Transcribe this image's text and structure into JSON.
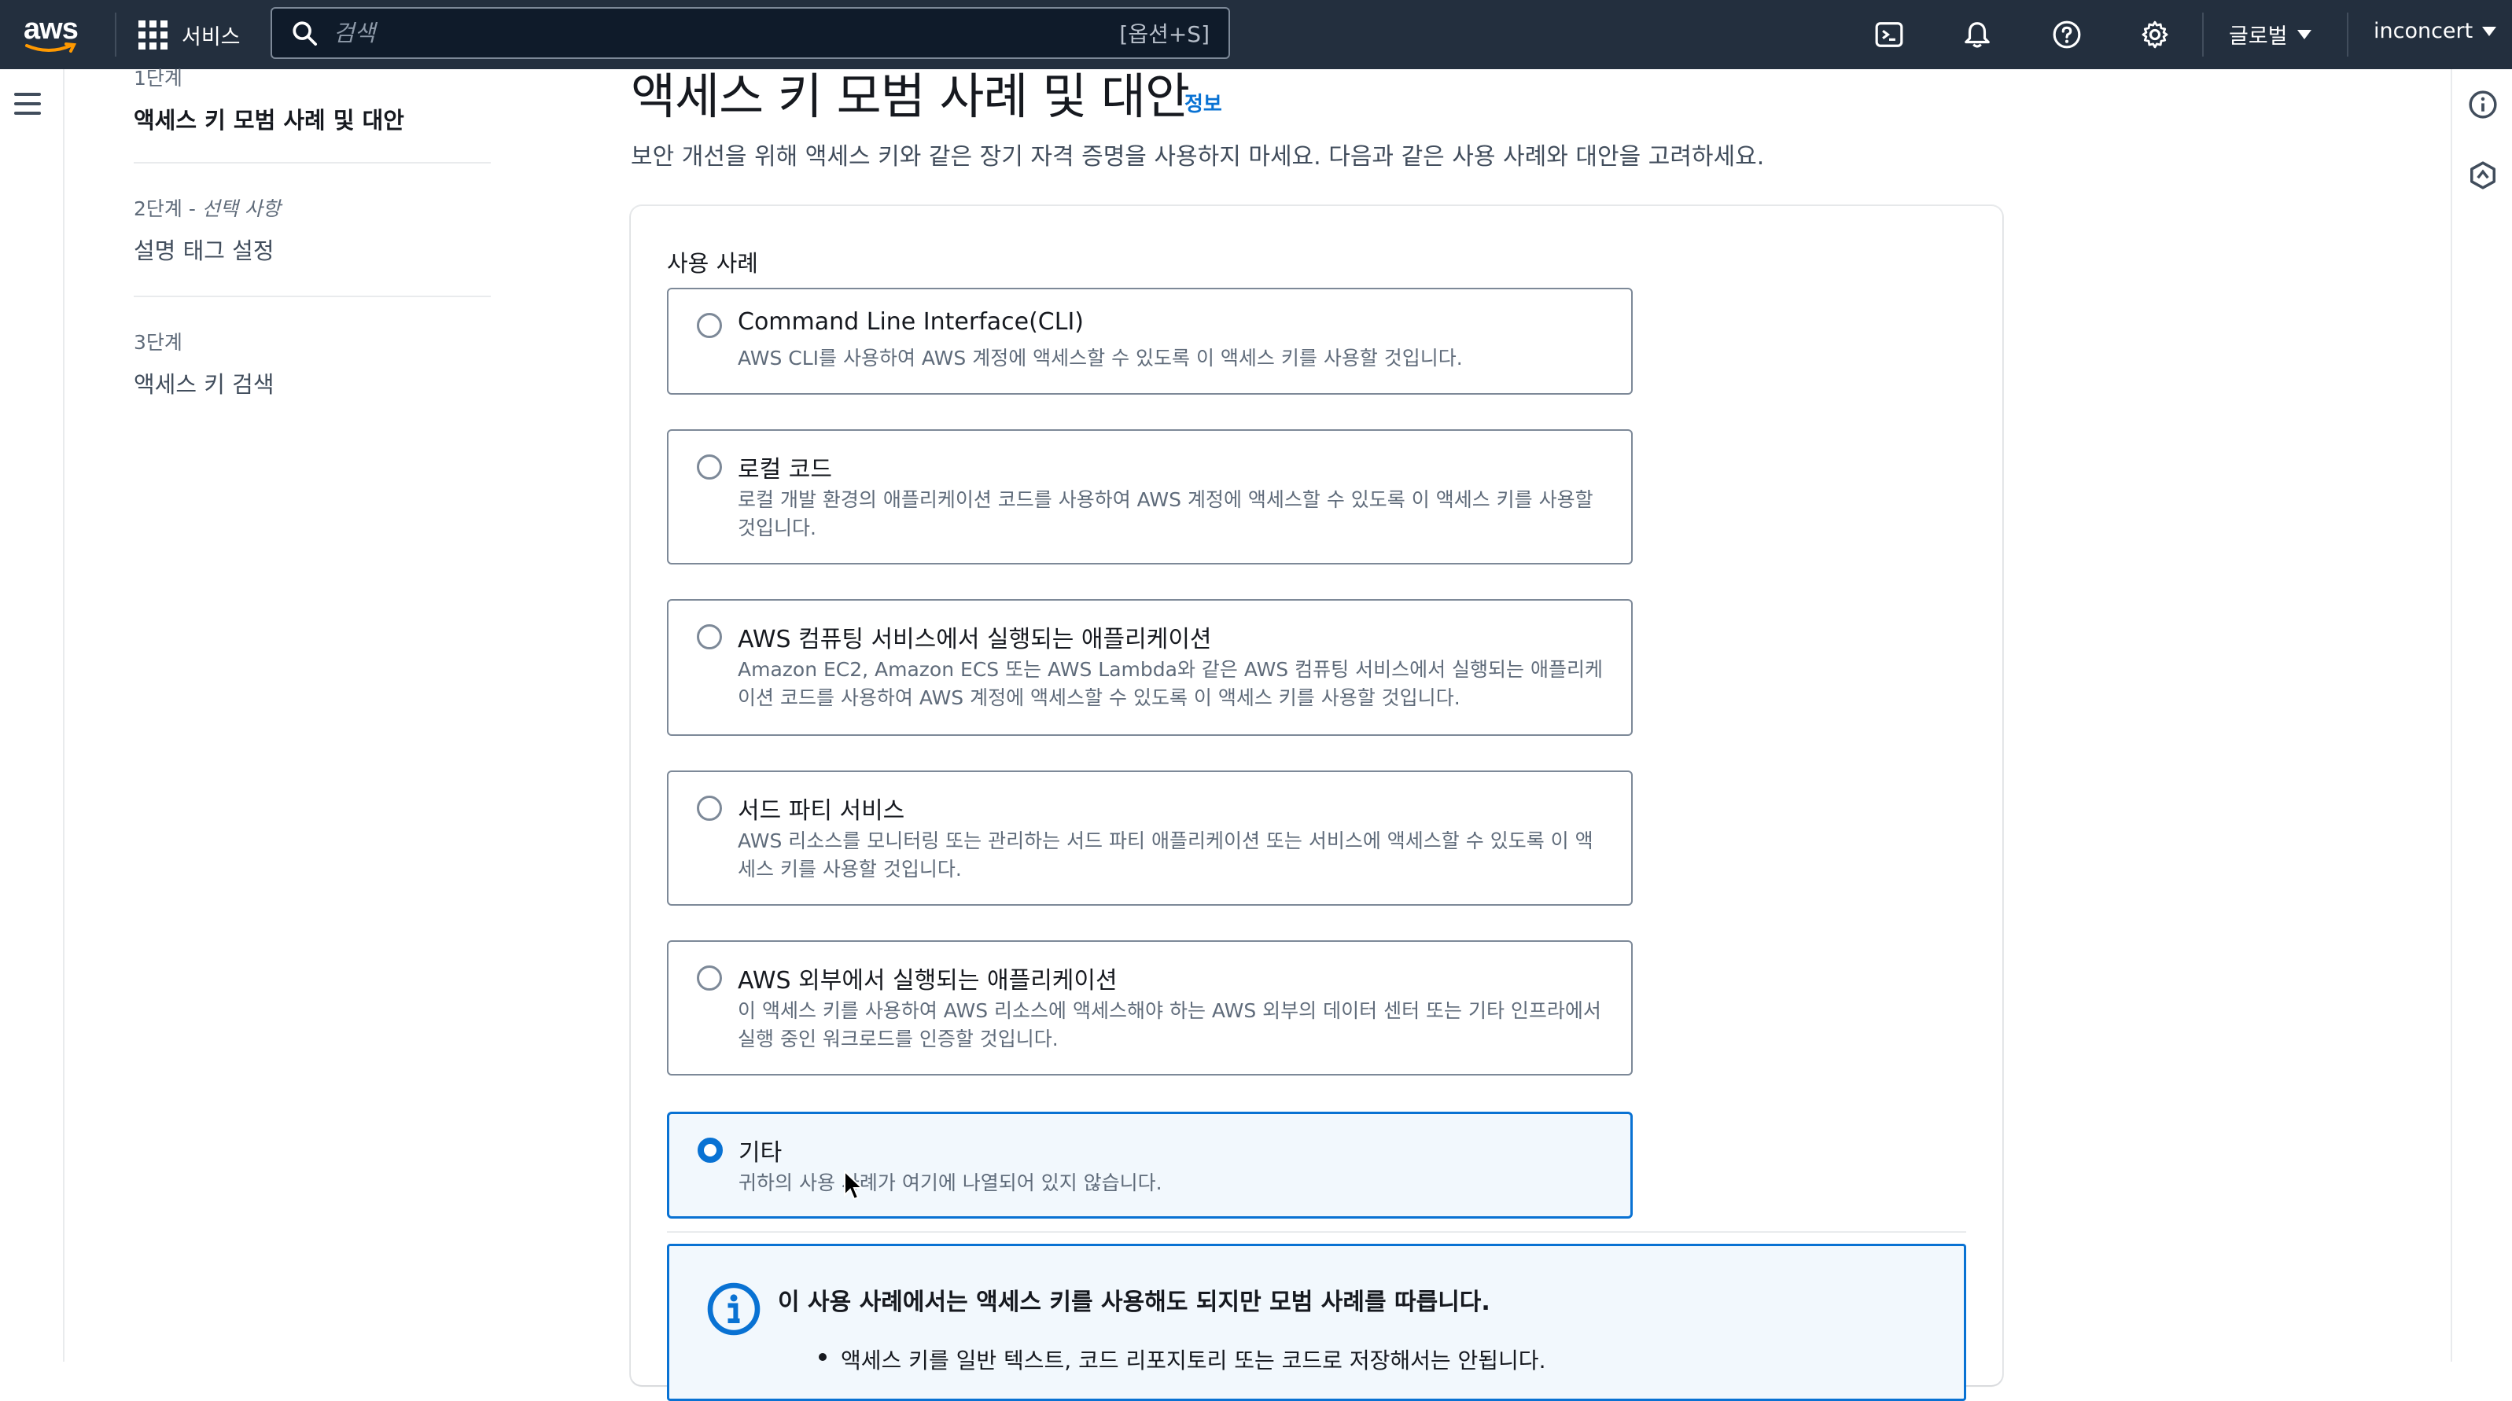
{
  "topnav": {
    "logo_text": "aws",
    "services_label": "서비스",
    "search_placeholder": "검색",
    "search_shortcut": "[옵션+S]",
    "region_label": "글로벌",
    "account_label": "inconcert"
  },
  "steps": [
    {
      "label": "1단계",
      "optional": "",
      "title": "액세스 키 모범 사례 및 대안",
      "active": true
    },
    {
      "label": "2단계 - ",
      "optional": "선택 사항",
      "title": "설명 태그 설정",
      "active": false
    },
    {
      "label": "3단계",
      "optional": "",
      "title": "액세스 키 검색",
      "active": false
    }
  ],
  "header": {
    "title": "액세스 키 모범 사례 및 대안",
    "info_link": "정보",
    "description": "보안 개선을 위해 액세스 키와 같은 장기 자격 증명을 사용하지 마세요. 다음과 같은 사용 사례와 대안을 고려하세요."
  },
  "usecases": {
    "label": "사용 사례",
    "selected_index": 5,
    "options": [
      {
        "title": "Command Line Interface(CLI)",
        "desc": "AWS CLI를 사용하여 AWS 계정에 액세스할 수 있도록 이 액세스 키를 사용할 것입니다."
      },
      {
        "title": "로컬 코드",
        "desc": "로컬 개발 환경의 애플리케이션 코드를 사용하여 AWS 계정에 액세스할 수 있도록 이 액세스 키를 사용할 것입니다."
      },
      {
        "title": "AWS 컴퓨팅 서비스에서 실행되는 애플리케이션",
        "desc": "Amazon EC2, Amazon ECS 또는 AWS Lambda와 같은 AWS 컴퓨팅 서비스에서 실행되는 애플리케이션 코드를 사용하여 AWS 계정에 액세스할 수 있도록 이 액세스 키를 사용할 것입니다."
      },
      {
        "title": "서드 파티 서비스",
        "desc": "AWS 리소스를 모니터링 또는 관리하는 서드 파티 애플리케이션 또는 서비스에 액세스할 수 있도록 이 액세스 키를 사용할 것입니다."
      },
      {
        "title": "AWS 외부에서 실행되는 애플리케이션",
        "desc": "이 액세스 키를 사용하여 AWS 리소스에 액세스해야 하는 AWS 외부의 데이터 센터 또는 기타 인프라에서 실행 중인 워크로드를 인증할 것입니다."
      },
      {
        "title": "기타",
        "desc": "귀하의 사용 사례가 여기에 나열되어 있지 않습니다."
      }
    ]
  },
  "alert": {
    "title": "이 사용 사례에서는 액세스 키를 사용해도 되지만 모범 사례를 따릅니다.",
    "bullet": "액세스 키를 일반 텍스트, 코드 리포지토리 또는 코드로 저장해서는 안됩니다."
  },
  "colors": {
    "nav_bg": "#232f3e",
    "accent": "#0972d3"
  }
}
